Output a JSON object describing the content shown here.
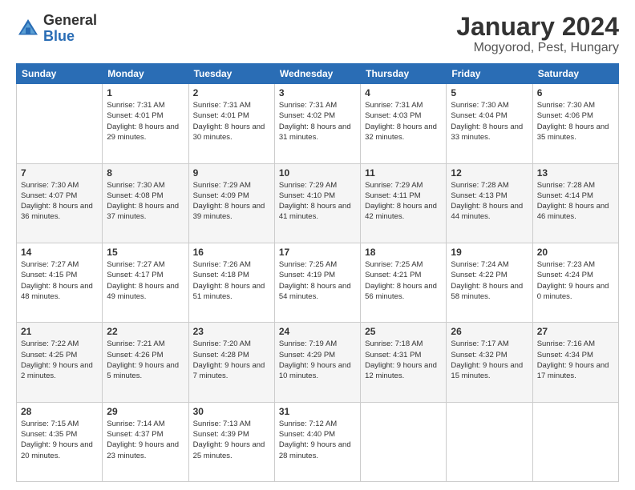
{
  "header": {
    "logo": {
      "general": "General",
      "blue": "Blue"
    },
    "title": "January 2024",
    "subtitle": "Mogyorod, Pest, Hungary"
  },
  "calendar": {
    "weekdays": [
      "Sunday",
      "Monday",
      "Tuesday",
      "Wednesday",
      "Thursday",
      "Friday",
      "Saturday"
    ],
    "weeks": [
      [
        {
          "day": "",
          "sunrise": "",
          "sunset": "",
          "daylight": ""
        },
        {
          "day": "1",
          "sunrise": "Sunrise: 7:31 AM",
          "sunset": "Sunset: 4:01 PM",
          "daylight": "Daylight: 8 hours and 29 minutes."
        },
        {
          "day": "2",
          "sunrise": "Sunrise: 7:31 AM",
          "sunset": "Sunset: 4:01 PM",
          "daylight": "Daylight: 8 hours and 30 minutes."
        },
        {
          "day": "3",
          "sunrise": "Sunrise: 7:31 AM",
          "sunset": "Sunset: 4:02 PM",
          "daylight": "Daylight: 8 hours and 31 minutes."
        },
        {
          "day": "4",
          "sunrise": "Sunrise: 7:31 AM",
          "sunset": "Sunset: 4:03 PM",
          "daylight": "Daylight: 8 hours and 32 minutes."
        },
        {
          "day": "5",
          "sunrise": "Sunrise: 7:30 AM",
          "sunset": "Sunset: 4:04 PM",
          "daylight": "Daylight: 8 hours and 33 minutes."
        },
        {
          "day": "6",
          "sunrise": "Sunrise: 7:30 AM",
          "sunset": "Sunset: 4:06 PM",
          "daylight": "Daylight: 8 hours and 35 minutes."
        }
      ],
      [
        {
          "day": "7",
          "sunrise": "Sunrise: 7:30 AM",
          "sunset": "Sunset: 4:07 PM",
          "daylight": "Daylight: 8 hours and 36 minutes."
        },
        {
          "day": "8",
          "sunrise": "Sunrise: 7:30 AM",
          "sunset": "Sunset: 4:08 PM",
          "daylight": "Daylight: 8 hours and 37 minutes."
        },
        {
          "day": "9",
          "sunrise": "Sunrise: 7:29 AM",
          "sunset": "Sunset: 4:09 PM",
          "daylight": "Daylight: 8 hours and 39 minutes."
        },
        {
          "day": "10",
          "sunrise": "Sunrise: 7:29 AM",
          "sunset": "Sunset: 4:10 PM",
          "daylight": "Daylight: 8 hours and 41 minutes."
        },
        {
          "day": "11",
          "sunrise": "Sunrise: 7:29 AM",
          "sunset": "Sunset: 4:11 PM",
          "daylight": "Daylight: 8 hours and 42 minutes."
        },
        {
          "day": "12",
          "sunrise": "Sunrise: 7:28 AM",
          "sunset": "Sunset: 4:13 PM",
          "daylight": "Daylight: 8 hours and 44 minutes."
        },
        {
          "day": "13",
          "sunrise": "Sunrise: 7:28 AM",
          "sunset": "Sunset: 4:14 PM",
          "daylight": "Daylight: 8 hours and 46 minutes."
        }
      ],
      [
        {
          "day": "14",
          "sunrise": "Sunrise: 7:27 AM",
          "sunset": "Sunset: 4:15 PM",
          "daylight": "Daylight: 8 hours and 48 minutes."
        },
        {
          "day": "15",
          "sunrise": "Sunrise: 7:27 AM",
          "sunset": "Sunset: 4:17 PM",
          "daylight": "Daylight: 8 hours and 49 minutes."
        },
        {
          "day": "16",
          "sunrise": "Sunrise: 7:26 AM",
          "sunset": "Sunset: 4:18 PM",
          "daylight": "Daylight: 8 hours and 51 minutes."
        },
        {
          "day": "17",
          "sunrise": "Sunrise: 7:25 AM",
          "sunset": "Sunset: 4:19 PM",
          "daylight": "Daylight: 8 hours and 54 minutes."
        },
        {
          "day": "18",
          "sunrise": "Sunrise: 7:25 AM",
          "sunset": "Sunset: 4:21 PM",
          "daylight": "Daylight: 8 hours and 56 minutes."
        },
        {
          "day": "19",
          "sunrise": "Sunrise: 7:24 AM",
          "sunset": "Sunset: 4:22 PM",
          "daylight": "Daylight: 8 hours and 58 minutes."
        },
        {
          "day": "20",
          "sunrise": "Sunrise: 7:23 AM",
          "sunset": "Sunset: 4:24 PM",
          "daylight": "Daylight: 9 hours and 0 minutes."
        }
      ],
      [
        {
          "day": "21",
          "sunrise": "Sunrise: 7:22 AM",
          "sunset": "Sunset: 4:25 PM",
          "daylight": "Daylight: 9 hours and 2 minutes."
        },
        {
          "day": "22",
          "sunrise": "Sunrise: 7:21 AM",
          "sunset": "Sunset: 4:26 PM",
          "daylight": "Daylight: 9 hours and 5 minutes."
        },
        {
          "day": "23",
          "sunrise": "Sunrise: 7:20 AM",
          "sunset": "Sunset: 4:28 PM",
          "daylight": "Daylight: 9 hours and 7 minutes."
        },
        {
          "day": "24",
          "sunrise": "Sunrise: 7:19 AM",
          "sunset": "Sunset: 4:29 PM",
          "daylight": "Daylight: 9 hours and 10 minutes."
        },
        {
          "day": "25",
          "sunrise": "Sunrise: 7:18 AM",
          "sunset": "Sunset: 4:31 PM",
          "daylight": "Daylight: 9 hours and 12 minutes."
        },
        {
          "day": "26",
          "sunrise": "Sunrise: 7:17 AM",
          "sunset": "Sunset: 4:32 PM",
          "daylight": "Daylight: 9 hours and 15 minutes."
        },
        {
          "day": "27",
          "sunrise": "Sunrise: 7:16 AM",
          "sunset": "Sunset: 4:34 PM",
          "daylight": "Daylight: 9 hours and 17 minutes."
        }
      ],
      [
        {
          "day": "28",
          "sunrise": "Sunrise: 7:15 AM",
          "sunset": "Sunset: 4:35 PM",
          "daylight": "Daylight: 9 hours and 20 minutes."
        },
        {
          "day": "29",
          "sunrise": "Sunrise: 7:14 AM",
          "sunset": "Sunset: 4:37 PM",
          "daylight": "Daylight: 9 hours and 23 minutes."
        },
        {
          "day": "30",
          "sunrise": "Sunrise: 7:13 AM",
          "sunset": "Sunset: 4:39 PM",
          "daylight": "Daylight: 9 hours and 25 minutes."
        },
        {
          "day": "31",
          "sunrise": "Sunrise: 7:12 AM",
          "sunset": "Sunset: 4:40 PM",
          "daylight": "Daylight: 9 hours and 28 minutes."
        },
        {
          "day": "",
          "sunrise": "",
          "sunset": "",
          "daylight": ""
        },
        {
          "day": "",
          "sunrise": "",
          "sunset": "",
          "daylight": ""
        },
        {
          "day": "",
          "sunrise": "",
          "sunset": "",
          "daylight": ""
        }
      ]
    ]
  }
}
